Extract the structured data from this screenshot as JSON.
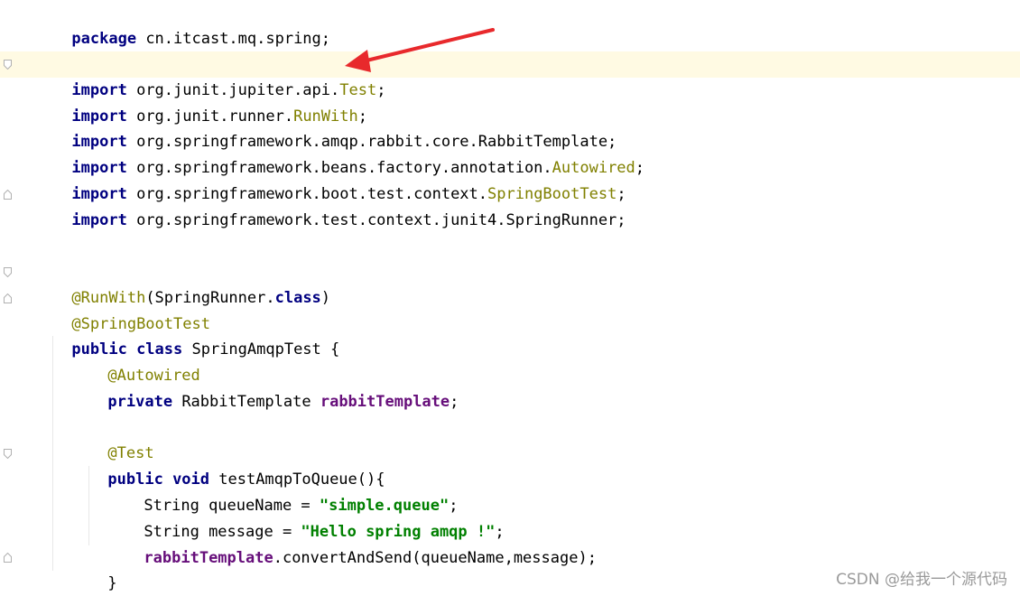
{
  "editor": {
    "lines": {
      "l1": [
        "package",
        " cn.itcast.mq.spring;"
      ],
      "l3": [
        "import",
        " org.junit.jupiter.api.",
        "Test",
        ";"
      ],
      "l4": [
        "import",
        " org.junit.runner.",
        "RunWith",
        ";"
      ],
      "l5": [
        "import",
        " org.springframework.amqp.rabbit.core.RabbitTemplate;"
      ],
      "l6": [
        "import",
        " org.springframework.beans.factory.annotation.",
        "Autowired",
        ";"
      ],
      "l7": [
        "import",
        " org.springframework.boot.test.context.",
        "SpringBootTest",
        ";"
      ],
      "l8": [
        "import",
        " org.springframework.test.context.junit4.SpringRunner;"
      ],
      "l11": [
        "@RunWith",
        "(SpringRunner.",
        "class",
        ")"
      ],
      "l12": [
        "@SpringBootTest"
      ],
      "l13": [
        "public class",
        " SpringAmqpTest {"
      ],
      "l14": [
        "@Autowired"
      ],
      "l15": [
        "private",
        " RabbitTemplate ",
        "rabbitTemplate",
        ";"
      ],
      "l17": [
        "@Test"
      ],
      "l18": [
        "public void",
        " testAmqpToQueue(){"
      ],
      "l19": [
        "String queueName = ",
        "\"simple.queue\"",
        ";"
      ],
      "l20": [
        "String message = ",
        "\"Hello spring amqp !\"",
        ";"
      ],
      "l21": [
        "rabbitTemplate",
        ".convertAndSend(queueName,message);"
      ],
      "l22": [
        "}"
      ]
    },
    "colors": {
      "keyword": "#000080",
      "annotation": "#808000",
      "string": "#008000",
      "field": "#660e7a",
      "current_line": "#fffae3",
      "arrow": "#e8292c"
    }
  },
  "watermark": "CSDN @给我一个源代码"
}
